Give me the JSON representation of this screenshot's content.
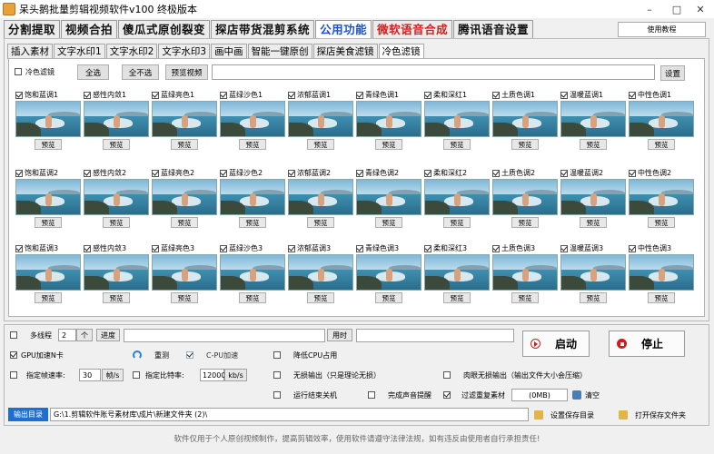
{
  "window": {
    "title": "呆头鹅批量剪辑视频软件v100 终极版本",
    "minimize": "–",
    "maximize": "□",
    "close": "✕"
  },
  "main_tabs": [
    {
      "label": "分割提取",
      "state": "normal"
    },
    {
      "label": "视频合拍",
      "state": "normal"
    },
    {
      "label": "傻瓜式原创裂变",
      "state": "normal"
    },
    {
      "label": "探店带货混剪系统",
      "state": "normal"
    },
    {
      "label": "公用功能",
      "state": "active"
    },
    {
      "label": "微软语音合成",
      "state": "red"
    },
    {
      "label": "腾讯语音设置",
      "state": "normal"
    }
  ],
  "help_button": "使用教程",
  "sub_tabs": [
    {
      "label": "插入素材",
      "active": false
    },
    {
      "label": "文字水印1",
      "active": false
    },
    {
      "label": "文字水印2",
      "active": false
    },
    {
      "label": "文字水印3",
      "active": false
    },
    {
      "label": "画中画",
      "active": false
    },
    {
      "label": "智能一键原创",
      "active": false
    },
    {
      "label": "探店美食滤镜",
      "active": false
    },
    {
      "label": "冷色滤镜",
      "active": true
    }
  ],
  "filter_controls": {
    "enable_label": "冷色滤镜",
    "enable_checked": false,
    "select_all": "全选",
    "select_none": "全不选",
    "preview_video": "预览视频",
    "path_value": "",
    "settings": "设置"
  },
  "filter_rows": [
    [
      {
        "label": "饱和蓝调1",
        "checked": true
      },
      {
        "label": "感性内敛1",
        "checked": true
      },
      {
        "label": "蓝绿亮色1",
        "checked": true
      },
      {
        "label": "蓝绿沙色1",
        "checked": true
      },
      {
        "label": "浓郁蓝调1",
        "checked": true
      },
      {
        "label": "青绿色调1",
        "checked": true
      },
      {
        "label": "柔和深红1",
        "checked": true
      },
      {
        "label": "土质色调1",
        "checked": true
      },
      {
        "label": "温暖蓝调1",
        "checked": true
      },
      {
        "label": "中性色调1",
        "checked": true
      }
    ],
    [
      {
        "label": "饱和蓝调2",
        "checked": true
      },
      {
        "label": "感性内敛2",
        "checked": true
      },
      {
        "label": "蓝绿亮色2",
        "checked": true
      },
      {
        "label": "蓝绿沙色2",
        "checked": true
      },
      {
        "label": "浓郁蓝调2",
        "checked": true
      },
      {
        "label": "青绿色调2",
        "checked": true
      },
      {
        "label": "柔和深红2",
        "checked": true
      },
      {
        "label": "土质色调2",
        "checked": true
      },
      {
        "label": "温暖蓝调2",
        "checked": true
      },
      {
        "label": "中性色调2",
        "checked": true
      }
    ],
    [
      {
        "label": "饱和蓝调3",
        "checked": true
      },
      {
        "label": "感性内敛3",
        "checked": true
      },
      {
        "label": "蓝绿亮色3",
        "checked": true
      },
      {
        "label": "蓝绿沙色3",
        "checked": true
      },
      {
        "label": "浓郁蓝调3",
        "checked": true
      },
      {
        "label": "青绿色调3",
        "checked": true
      },
      {
        "label": "柔和深红3",
        "checked": true
      },
      {
        "label": "土质色调3",
        "checked": true
      },
      {
        "label": "温暖蓝调3",
        "checked": true
      },
      {
        "label": "中性色调3",
        "checked": true
      }
    ]
  ],
  "preview_label": "预览",
  "bottom": {
    "multithread_label": "多线程",
    "multithread_checked": false,
    "thread_count": "2",
    "thread_unit": "个",
    "progress_label": "进度",
    "progress": 0,
    "time_label": "用时",
    "time_value": "",
    "start_button": "启动",
    "stop_button": "停止",
    "gpu_label": "GPU加速N卡",
    "gpu_checked": true,
    "retest_label": "重测",
    "cpu_accel_label": "C-PU加速",
    "cpu_accel_checked": true,
    "low_cpu_label": "降低CPU占用",
    "low_cpu_checked": false,
    "fps_label": "指定帧速率:",
    "fps_checked": false,
    "fps_value": "30",
    "fps_unit": "帧/s",
    "bitrate_label": "指定比特率:",
    "bitrate_checked": false,
    "bitrate_value": "12000",
    "bitrate_unit": "kb/s",
    "lossless_label": "无损输出（只是理论无损）",
    "lossless_checked": false,
    "visual_lossless_label": "肉眼无损输出（输出文件大小会压缩）",
    "visual_lossless_checked": false,
    "shutdown_label": "运行结束关机",
    "shutdown_checked": false,
    "sound_label": "完成声音提醒",
    "sound_checked": false,
    "filter_dup_label": "过滤重复素材",
    "filter_dup_checked": true,
    "dup_size": "(0MB)",
    "clear_label": "清空",
    "output_dir_button": "输出目录",
    "output_dir_value": "G:\\1.剪辑软件账号素材库\\成片\\新建文件夹 (2)\\",
    "set_save_dir": "设置保存目录",
    "open_save_dir": "打开保存文件夹"
  },
  "footer": "软件仅用于个人原创视频制作，提高剪辑效率，使用软件请遵守法律法规，如有违反由使用者自行承担责任!"
}
